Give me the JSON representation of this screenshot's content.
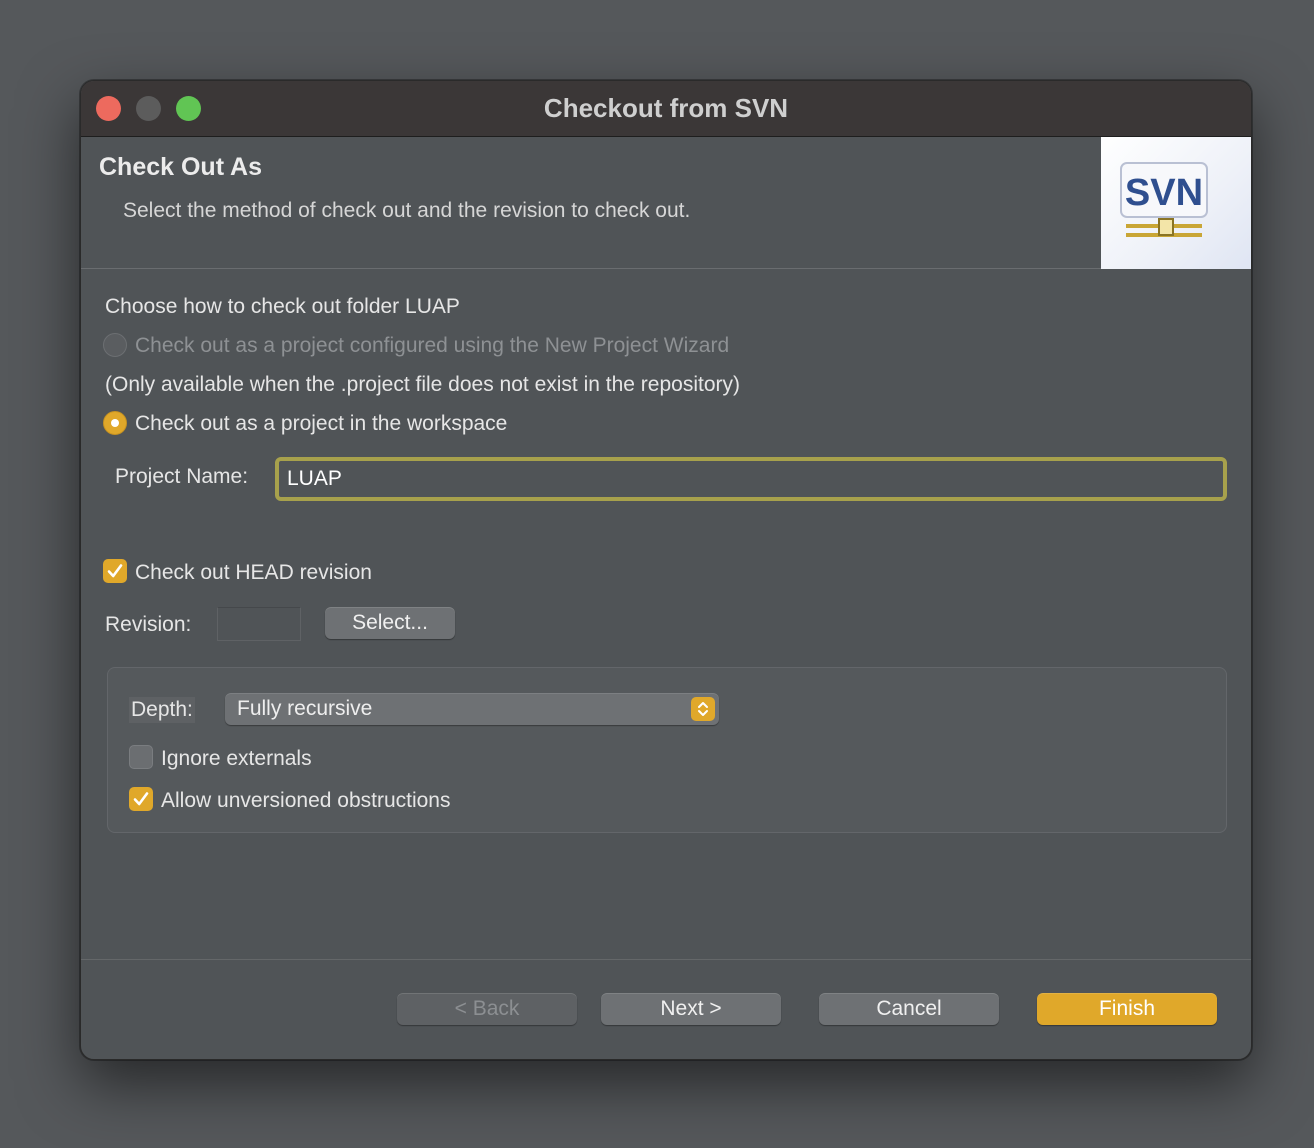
{
  "window": {
    "title": "Checkout from SVN"
  },
  "header": {
    "title": "Check Out As",
    "description": "Select the method of check out and the revision to check out.",
    "logo_text": "SVN"
  },
  "body": {
    "choose_label": "Choose how to check out folder LUAP",
    "option_wizard": "Check out as a project configured using the New Project Wizard",
    "wizard_note": "(Only available when the .project file does not exist in the repository)",
    "option_workspace": "Check out as a project in the workspace",
    "project_name_label": "Project Name:",
    "project_name_value": "LUAP",
    "head_revision_label": "Check out HEAD revision",
    "revision_label": "Revision:",
    "revision_value": "",
    "select_button": "Select..."
  },
  "options_group": {
    "depth_label": "Depth:",
    "depth_value": "Fully recursive",
    "ignore_externals": "Ignore externals",
    "allow_unversioned": "Allow unversioned obstructions"
  },
  "footer": {
    "back": "< Back",
    "next": "Next >",
    "cancel": "Cancel",
    "finish": "Finish"
  },
  "colors": {
    "accent": "#e0a82a",
    "window_bg": "#505457",
    "titlebar_bg": "#3b3737",
    "input_border": "#a7a14c"
  },
  "icons": {
    "close": "close-traffic-light",
    "minimize": "minimize-traffic-light",
    "maximize": "maximize-traffic-light",
    "logo": "svn-logo-icon",
    "check": "checkmark-icon",
    "select_arrows": "up-down-chevron-icon"
  }
}
